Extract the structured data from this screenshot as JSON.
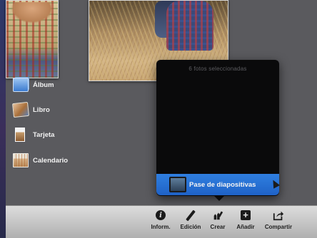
{
  "popover": {
    "header": "6 fotos seleccionadas",
    "items": [
      {
        "label": "Álbum",
        "icon": "photo-album-icon"
      },
      {
        "label": "Libro",
        "icon": "photo-book-icon"
      },
      {
        "label": "Tarjeta",
        "icon": "greeting-card-icon"
      },
      {
        "label": "Calendario",
        "icon": "calendar-icon"
      },
      {
        "label": "Pase de diapositivas",
        "icon": "slideshow-icon",
        "selected": true
      }
    ]
  },
  "toolbar": {
    "buttons": [
      {
        "label": "Inform.",
        "icon": "info-icon"
      },
      {
        "label": "Edición",
        "icon": "pencil-icon"
      },
      {
        "label": "Crear",
        "icon": "create-icon"
      },
      {
        "label": "Añadir",
        "icon": "add-icon"
      },
      {
        "label": "Compartir",
        "icon": "share-icon"
      }
    ]
  },
  "colors": {
    "selection": "#2f7fe0",
    "popover_bg": "#0a0a0b",
    "canvas_bg": "#5a5a5e",
    "toolbar_bg": "#c4c4c4"
  }
}
